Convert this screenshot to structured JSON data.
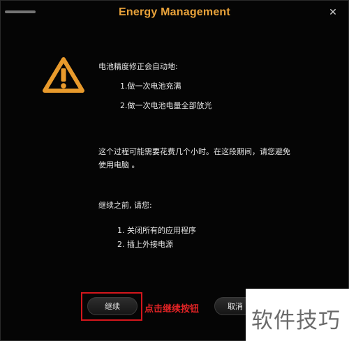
{
  "window": {
    "title": "Energy Management",
    "close_glyph": "✕"
  },
  "dialog": {
    "icon": "warning-icon",
    "intro": "电池精度修正会自动地:",
    "auto_steps": [
      "1.做一次电池充满",
      "2.做一次电池电量全部放光"
    ],
    "notice_line1": "这个过程可能需要花费几个小时。在这段期间，请您避免",
    "notice_line2": "使用电脑 。",
    "before_label": "继续之前, 请您:",
    "before_steps": [
      "1. 关闭所有的应用程序",
      "2. 插上外接电源"
    ]
  },
  "buttons": {
    "continue_label": "继续",
    "cancel_label": "取消"
  },
  "annotation": {
    "text": "点击继续按钮",
    "color": "#e22325"
  },
  "watermark": {
    "text": "软件技巧"
  },
  "colors": {
    "title": "#e8a23a",
    "warning": "#e89a2c",
    "background": "#050505"
  }
}
